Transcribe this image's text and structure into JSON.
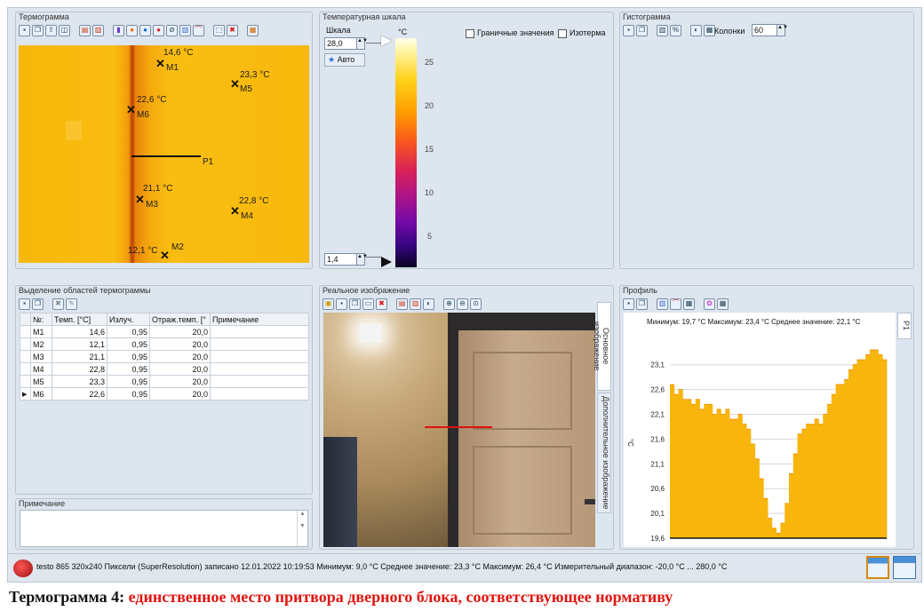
{
  "panels": {
    "thermogram": "Термограмма",
    "temp_scale": "Температурная шкала",
    "histogram": "Гистограмма",
    "regions": "Выделение областей термограммы",
    "real_image": "Реальное изображение",
    "profile": "Профиль",
    "note": "Примечание"
  },
  "thermogram": {
    "markers": [
      {
        "id": "M1",
        "temp": "14,6 °C"
      },
      {
        "id": "M2",
        "temp": "12,1 °C"
      },
      {
        "id": "M3",
        "temp": "21,1 °C"
      },
      {
        "id": "M4",
        "temp": "22,8 °C"
      },
      {
        "id": "M5",
        "temp": "23,3 °C"
      },
      {
        "id": "M6",
        "temp": "22,6 °C"
      }
    ],
    "profile_label": "P1"
  },
  "scale": {
    "label": "Шкала",
    "max": "28,0",
    "min": "1,4",
    "auto": "Авто",
    "unit": "°C",
    "ticks": [
      "25",
      "20",
      "15",
      "10",
      "5"
    ],
    "boundary": "Граничные значения",
    "isotherm": "Изотерма"
  },
  "histogram": {
    "columns_label": "Колонки",
    "columns": "60"
  },
  "regions_table": {
    "headers": [
      "№:",
      "Темп. [°C]",
      "Излуч.",
      "Отраж.темп. [°",
      "Примечание"
    ],
    "rows": [
      [
        "M1",
        "14,6",
        "0,95",
        "20,0",
        ""
      ],
      [
        "M2",
        "12,1",
        "0,95",
        "20,0",
        ""
      ],
      [
        "M3",
        "21,1",
        "0,95",
        "20,0",
        ""
      ],
      [
        "M4",
        "22,8",
        "0,95",
        "20,0",
        ""
      ],
      [
        "M5",
        "23,3",
        "0,95",
        "20,0",
        ""
      ],
      [
        "M6",
        "22,6",
        "0,95",
        "20,0",
        ""
      ]
    ]
  },
  "real_tabs": {
    "main": "Основное изображение",
    "extra": "Дополнительное изображение"
  },
  "profile": {
    "stats": "Минимум: 19,7 °C Максимум: 23,4 °C Среднее значение: 22,1 °C",
    "tab": "P1",
    "ylabel": "°C"
  },
  "chart_data": {
    "type": "area",
    "title": "",
    "ylabel": "°C",
    "yticks": [
      "23,1",
      "22,6",
      "22,1",
      "21,6",
      "21,1",
      "20,6",
      "20,1",
      "19,6"
    ],
    "ylim": [
      19.6,
      23.4
    ],
    "values": [
      22.7,
      22.5,
      22.6,
      22.4,
      22.4,
      22.3,
      22.4,
      22.2,
      22.3,
      22.3,
      22.1,
      22.2,
      22.1,
      22.2,
      22.0,
      22.0,
      22.1,
      21.9,
      21.8,
      21.5,
      21.2,
      20.8,
      20.4,
      20.0,
      19.8,
      19.7,
      19.9,
      20.3,
      20.9,
      21.3,
      21.7,
      21.8,
      21.9,
      21.9,
      22.0,
      21.9,
      22.1,
      22.3,
      22.5,
      22.7,
      22.7,
      22.8,
      23.0,
      23.1,
      23.2,
      23.2,
      23.3,
      23.4,
      23.4,
      23.3,
      23.2
    ],
    "colors": {
      "fill": "#f8b60c",
      "edge": "#f09206"
    }
  },
  "status": {
    "text": "testo 865 320x240 Пиксели (SuperResolution) записано 12.01.2022 10:19:53 Минимум: 9,0 °C  Среднее значение: 23,3 °C  Максимум: 26,4 °C  Измерительный диапазон: -20,0 °C ... 280,0 °C"
  },
  "caption": {
    "prefix": "Термограмма  4",
    "sep": ": ",
    "text": "единственное место притвора дверного блока, соответствующее нормативу"
  }
}
